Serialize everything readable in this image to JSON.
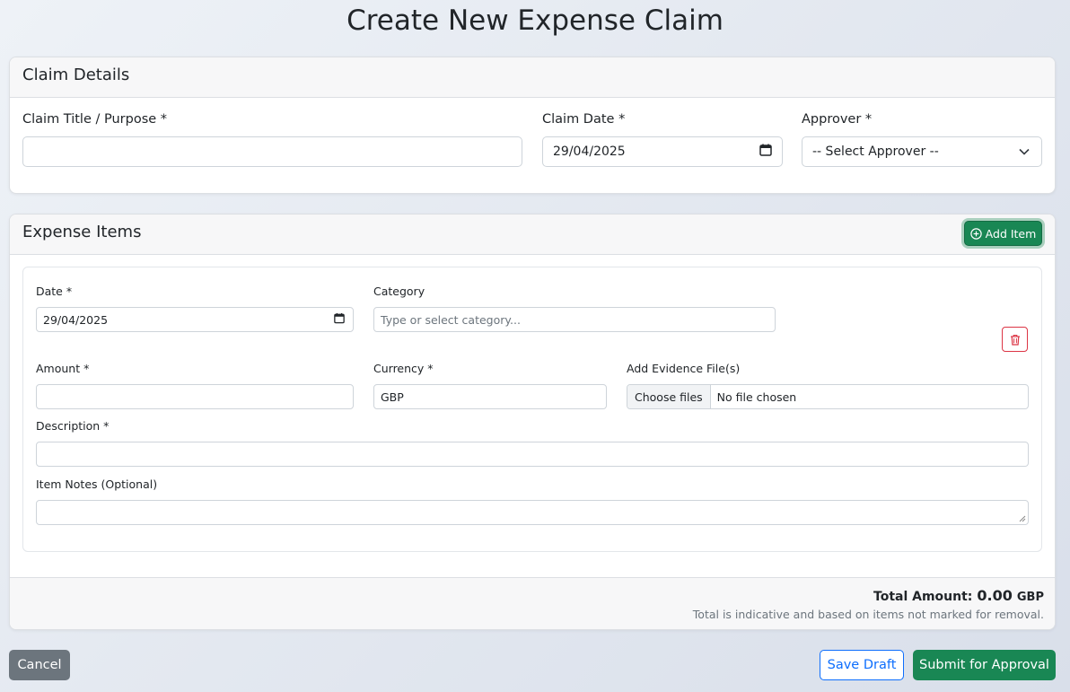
{
  "page": {
    "title": "Create New Expense Claim"
  },
  "claim_details": {
    "heading": "Claim Details",
    "title_label": "Claim Title / Purpose *",
    "title_value": "",
    "date_label": "Claim Date *",
    "date_value": "29/04/2025",
    "approver_label": "Approver *",
    "approver_selected": "-- Select Approver --"
  },
  "expense_items": {
    "heading": "Expense Items",
    "add_item_label": "Add Item",
    "item": {
      "date_label": "Date *",
      "date_value": "29/04/2025",
      "category_label": "Category",
      "category_placeholder": "Type or select category...",
      "amount_label": "Amount *",
      "amount_value": "",
      "currency_label": "Currency *",
      "currency_value": "GBP",
      "evidence_label": "Add Evidence File(s)",
      "choose_files_label": "Choose files",
      "no_file_text": "No file chosen",
      "description_label": "Description *",
      "description_value": "",
      "notes_label": "Item Notes (Optional)",
      "notes_value": ""
    },
    "total_label": "Total Amount:",
    "total_value": "0.00",
    "total_currency": "GBP",
    "total_note": "Total is indicative and based on items not marked for removal."
  },
  "actions": {
    "cancel_label": "Cancel",
    "save_draft_label": "Save Draft",
    "submit_label": "Submit for Approval"
  },
  "colors": {
    "primary": "#0d6efd",
    "success": "#198754",
    "danger": "#dc3545",
    "secondary": "#6c757d"
  },
  "icons": {
    "add": "plus-circle-icon",
    "delete": "trash-icon",
    "calendar": "calendar-icon",
    "dropdown": "chevron-down-icon"
  }
}
